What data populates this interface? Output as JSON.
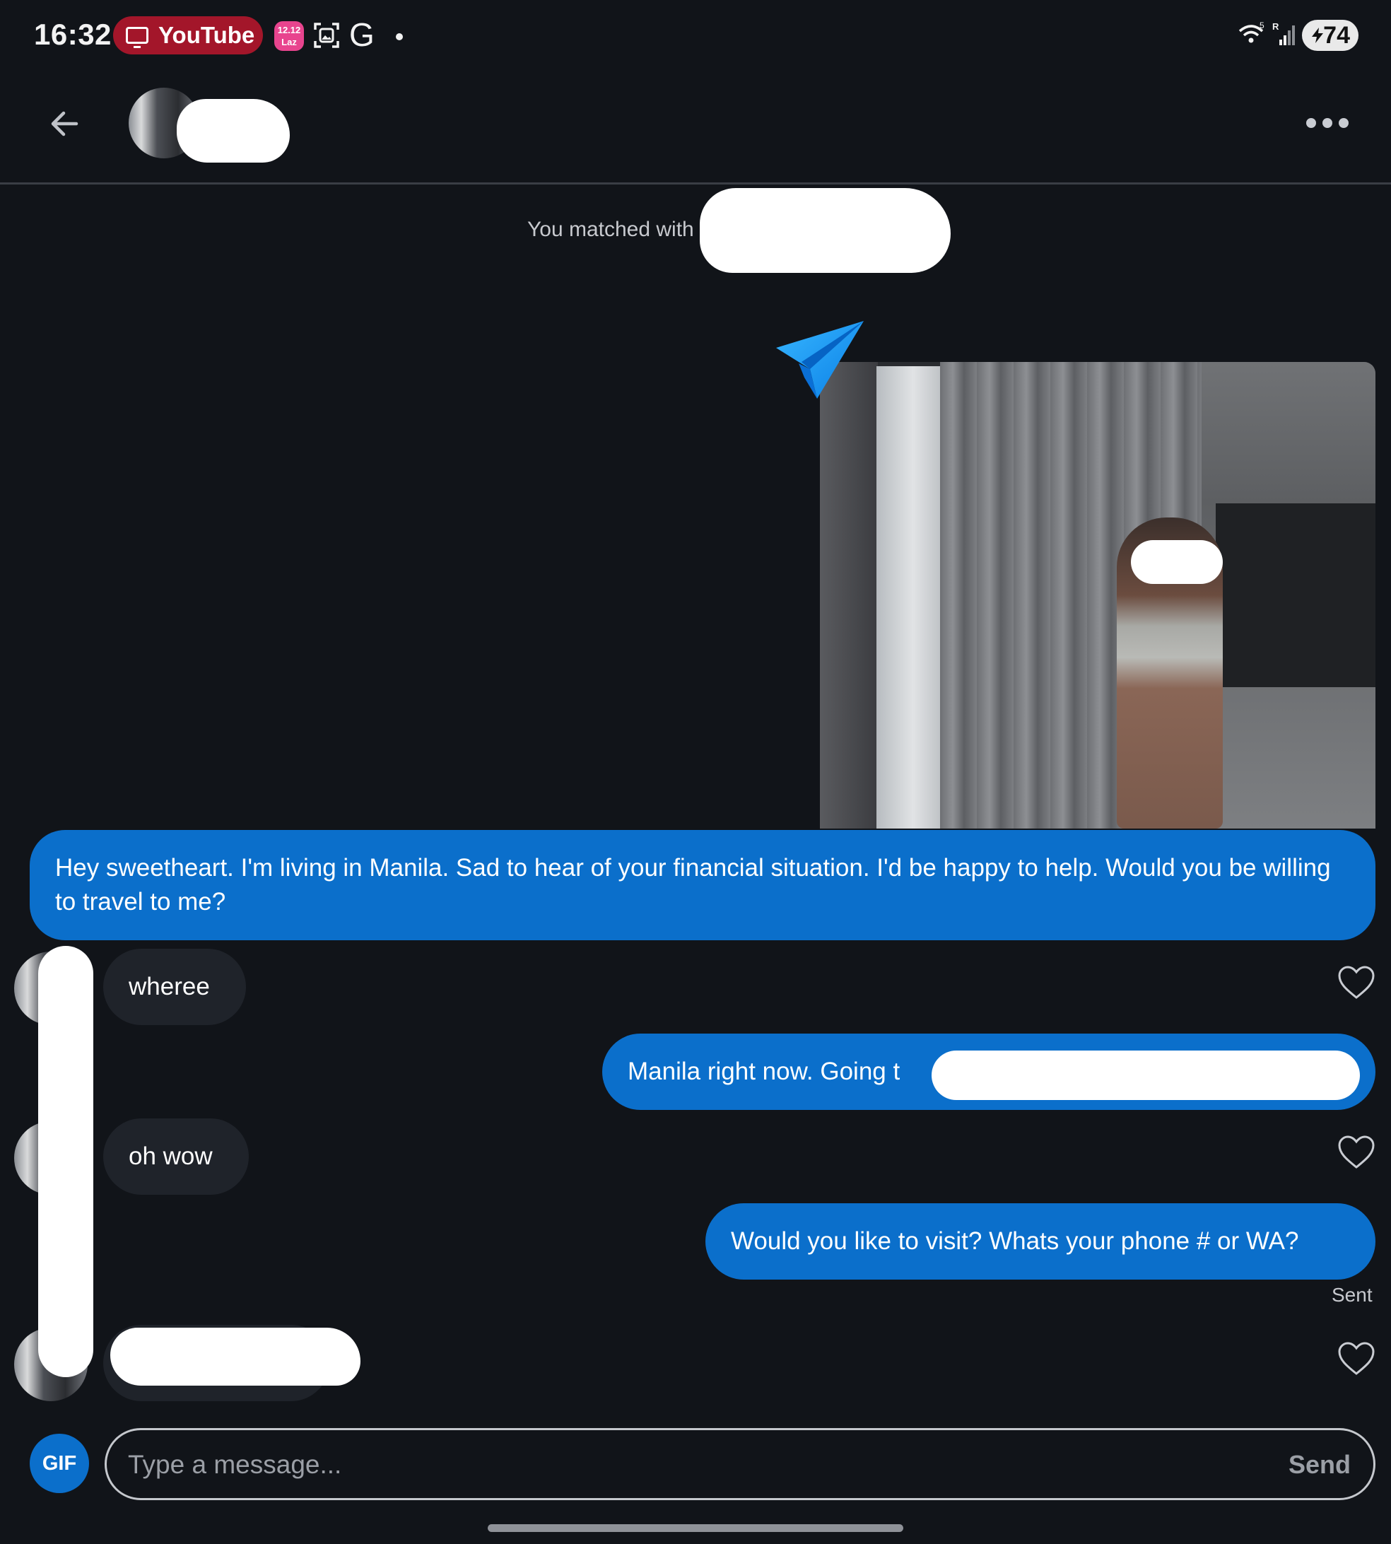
{
  "status_bar": {
    "time": "16:32",
    "app_pill_label": "YouTube",
    "lazada_badge": "12.12",
    "lazada_short": "Laz",
    "network_wifi_gen": "5",
    "network_roaming": "R",
    "battery_level": "74",
    "icons": [
      "tv-icon",
      "lazada-icon",
      "screenshot-icon",
      "g-icon",
      "notification-dot",
      "wifi-icon",
      "signal-icon",
      "battery-icon"
    ]
  },
  "header": {
    "icons": [
      "back-arrow-icon",
      "more-icon"
    ]
  },
  "conversation": {
    "match_notice": "You matched with",
    "messages": [
      {
        "direction": "out",
        "text": "Hey sweetheart. I'm living in Manila. Sad to hear of your financial situation. I'd be happy to help. Would you be willing to travel to me?"
      },
      {
        "direction": "in",
        "text": "wheree"
      },
      {
        "direction": "out",
        "text": "Manila right now. Going t"
      },
      {
        "direction": "in",
        "text": "oh wow"
      },
      {
        "direction": "out",
        "text": "Would you like to visit? Whats your phone # or WA?"
      },
      {
        "direction": "in",
        "text": ""
      }
    ],
    "status": "Sent"
  },
  "composer": {
    "gif_label": "GIF",
    "placeholder": "Type a message...",
    "send_label": "Send"
  },
  "colors": {
    "background": "#111419",
    "outgoing_bubble": "#0b6fcb",
    "incoming_bubble": "#1f232a",
    "youtube_pill": "#a3162a"
  }
}
